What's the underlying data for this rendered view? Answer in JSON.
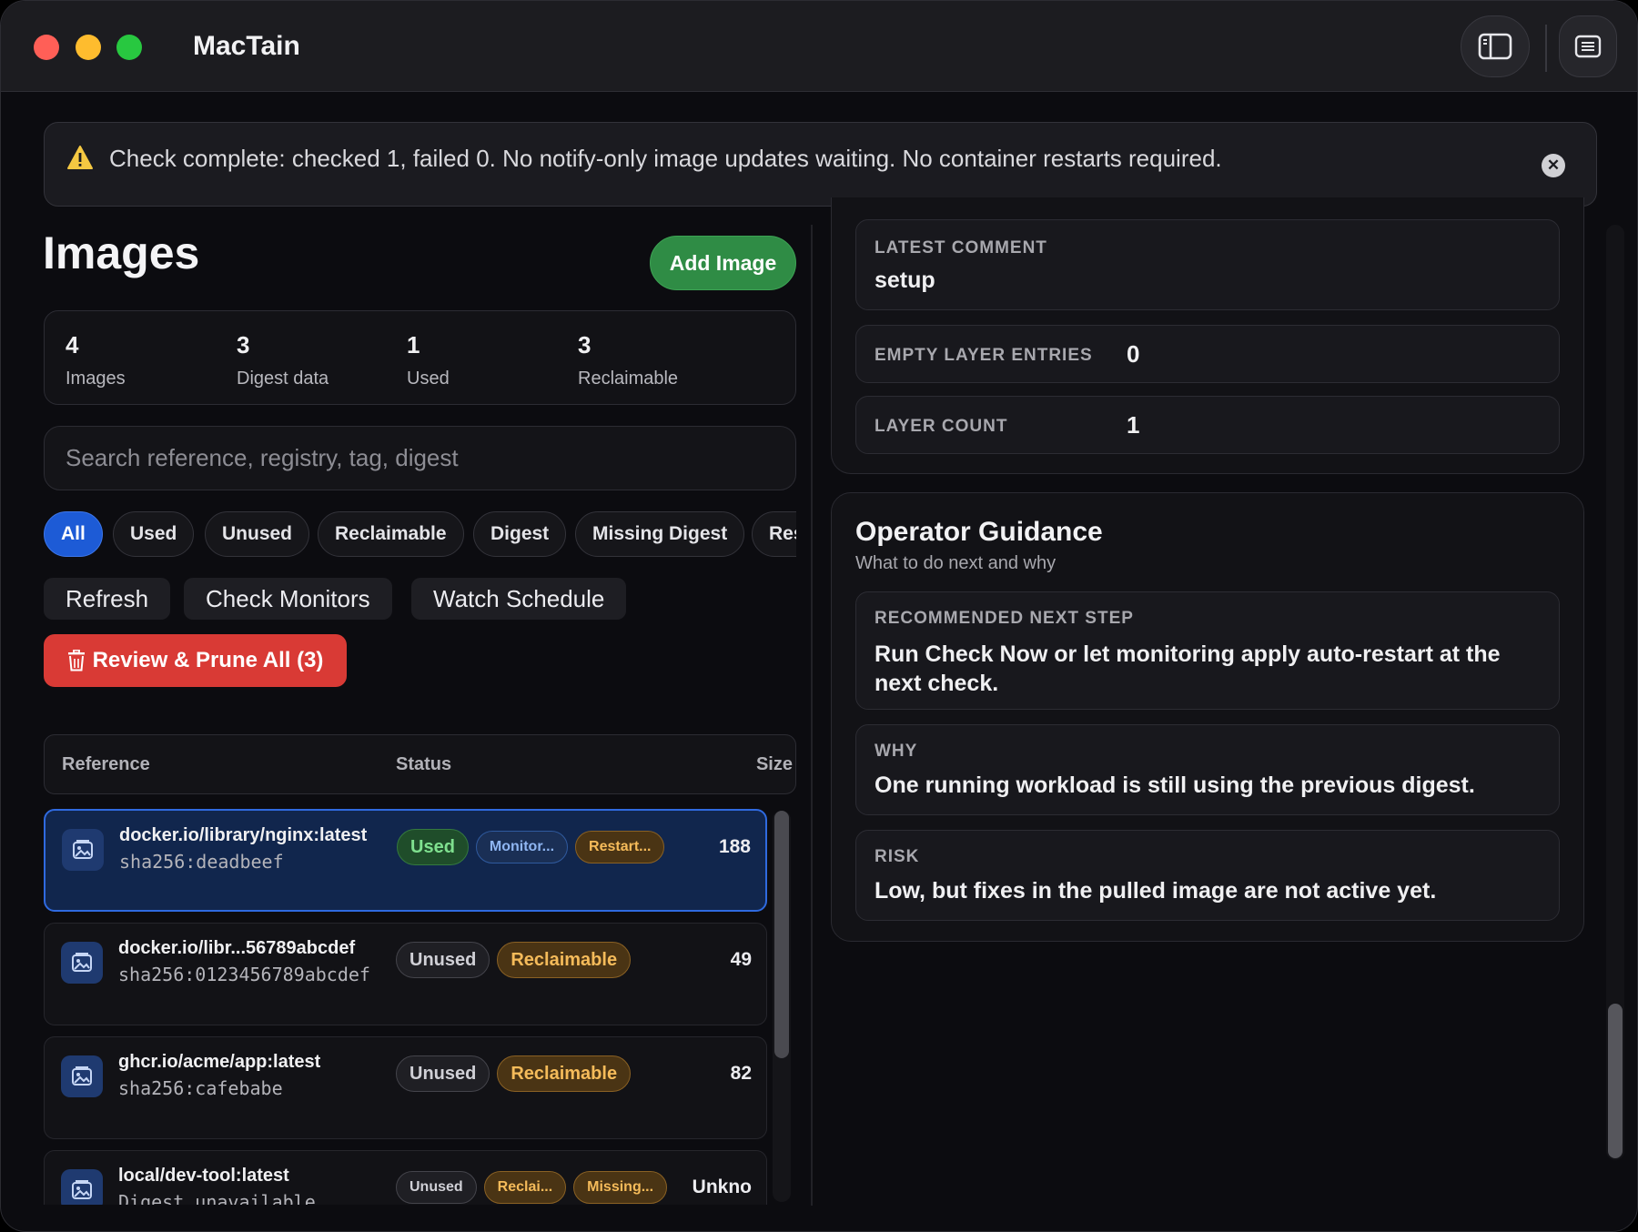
{
  "app": {
    "title": "MacTain"
  },
  "alert": {
    "message": "Check complete: checked 1, failed 0. No notify-only image updates waiting. No container restarts required.",
    "close_glyph": "✕"
  },
  "page": {
    "title": "Images",
    "add_label": "Add Image"
  },
  "stats": [
    {
      "value": "4",
      "label": "Images"
    },
    {
      "value": "3",
      "label": "Digest data"
    },
    {
      "value": "1",
      "label": "Used"
    },
    {
      "value": "3",
      "label": "Reclaimable"
    }
  ],
  "search": {
    "placeholder": "Search reference, registry, tag, digest"
  },
  "filters": [
    "All",
    "Used",
    "Unused",
    "Reclaimable",
    "Digest",
    "Missing Digest",
    "Res"
  ],
  "actions": {
    "refresh": "Refresh",
    "check_monitors": "Check Monitors",
    "watch_schedule": "Watch Schedule",
    "prune": "Review & Prune All (3)"
  },
  "table": {
    "columns": [
      "Reference",
      "Status",
      "Size"
    ],
    "rows": [
      {
        "name": "docker.io/library/nginx:latest",
        "digest": "sha256:deadbeef",
        "badges": [
          "Used",
          "Monitor...",
          "Restart..."
        ],
        "size": "188"
      },
      {
        "name": "docker.io/libr...56789abcdef",
        "digest": "sha256:0123456789abcdef",
        "badges": [
          "Unused",
          "Reclaimable"
        ],
        "size": "49"
      },
      {
        "name": "ghcr.io/acme/app:latest",
        "digest": "sha256:cafebabe",
        "badges": [
          "Unused",
          "Reclaimable"
        ],
        "size": "82"
      },
      {
        "name": "local/dev-tool:latest",
        "digest": "Digest unavailable",
        "badges": [
          "Unused",
          "Reclai...",
          "Missing..."
        ],
        "size": "Unkno"
      }
    ]
  },
  "details": {
    "latest_comment_label": "LATEST COMMENT",
    "latest_comment_value": "setup",
    "empty_layer_label": "EMPTY LAYER ENTRIES",
    "empty_layer_value": "0",
    "layer_count_label": "LAYER COUNT",
    "layer_count_value": "1"
  },
  "guidance": {
    "title": "Operator Guidance",
    "subtitle": "What to do next and why",
    "next_step_label": "RECOMMENDED NEXT STEP",
    "next_step_value": "Run Check Now or let monitoring apply auto-restart at the next check.",
    "why_label": "WHY",
    "why_value": "One running workload is still using the previous digest.",
    "risk_label": "RISK",
    "risk_value": "Low, but fixes in the pulled image are not active yet."
  },
  "colors": {
    "accent_blue": "#1d5bd6",
    "success_green": "#2f8c45",
    "danger_red": "#d93a35",
    "warning_amber": "#f5bb5a"
  }
}
